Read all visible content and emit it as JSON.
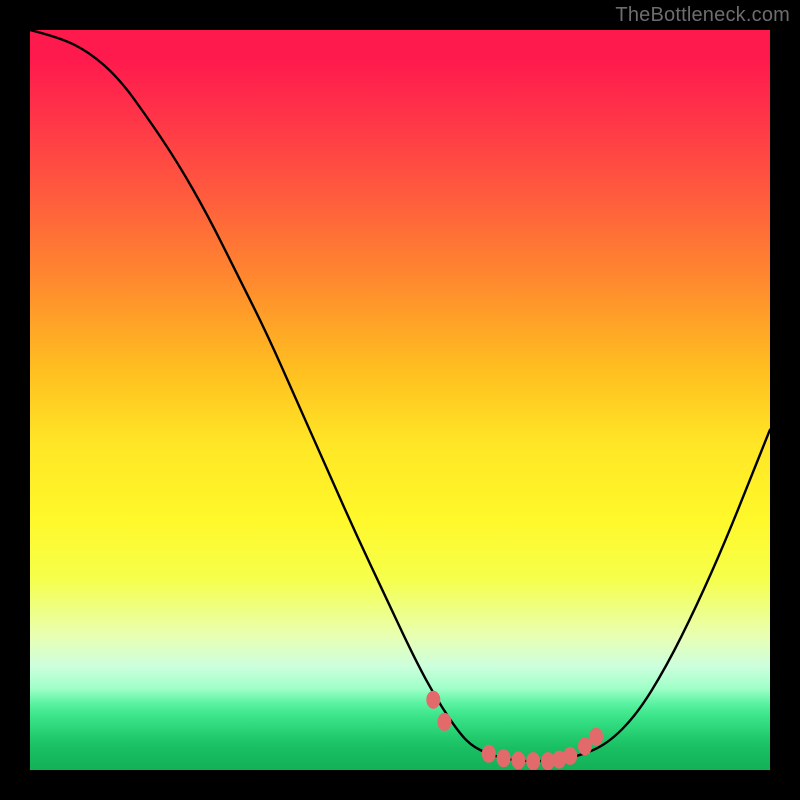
{
  "watermark": "TheBottleneck.com",
  "colors": {
    "page_bg": "#000000",
    "curve_stroke": "#000000",
    "marker_fill": "#e26a6a",
    "watermark_text": "#6d6d6d",
    "gradient_stops": [
      "#ff1a4d",
      "#ff5a3e",
      "#ffbf20",
      "#fff82a",
      "#e8ffb4",
      "#5bf2a2",
      "#13b058"
    ]
  },
  "chart_data": {
    "type": "line",
    "title": "",
    "xlabel": "",
    "ylabel": "",
    "xlim": [
      0,
      100
    ],
    "ylim": [
      0,
      100
    ],
    "note": "x is normalized horizontal position (0 = left edge of plot, 100 = right edge). y is the curve height as percent of plot height (0 = bottom, 100 = top). Values estimated from pixels; no axis labels are rendered in the source image.",
    "series": [
      {
        "name": "bottleneck-curve",
        "x": [
          0,
          4,
          8,
          12,
          16,
          20,
          24,
          28,
          32,
          36,
          40,
          44,
          48,
          52,
          55,
          58,
          60,
          63,
          66,
          70,
          74,
          78,
          82,
          86,
          90,
          94,
          98,
          100
        ],
        "y": [
          100,
          99,
          97,
          93.5,
          88,
          82,
          75,
          67,
          59,
          50,
          41,
          32,
          23.5,
          15,
          9.5,
          5,
          3,
          1.8,
          1.2,
          1.2,
          1.8,
          3.5,
          7.5,
          14,
          22,
          31,
          41,
          46
        ]
      }
    ],
    "markers": {
      "name": "sweet-spot-markers",
      "note": "pink dots near curve minimum",
      "x": [
        54.5,
        56,
        62,
        64,
        66,
        68,
        70,
        71.5,
        73,
        75,
        76.5
      ],
      "y": [
        9.5,
        6.5,
        2.2,
        1.6,
        1.3,
        1.2,
        1.2,
        1.4,
        1.9,
        3.2,
        4.5
      ]
    }
  }
}
